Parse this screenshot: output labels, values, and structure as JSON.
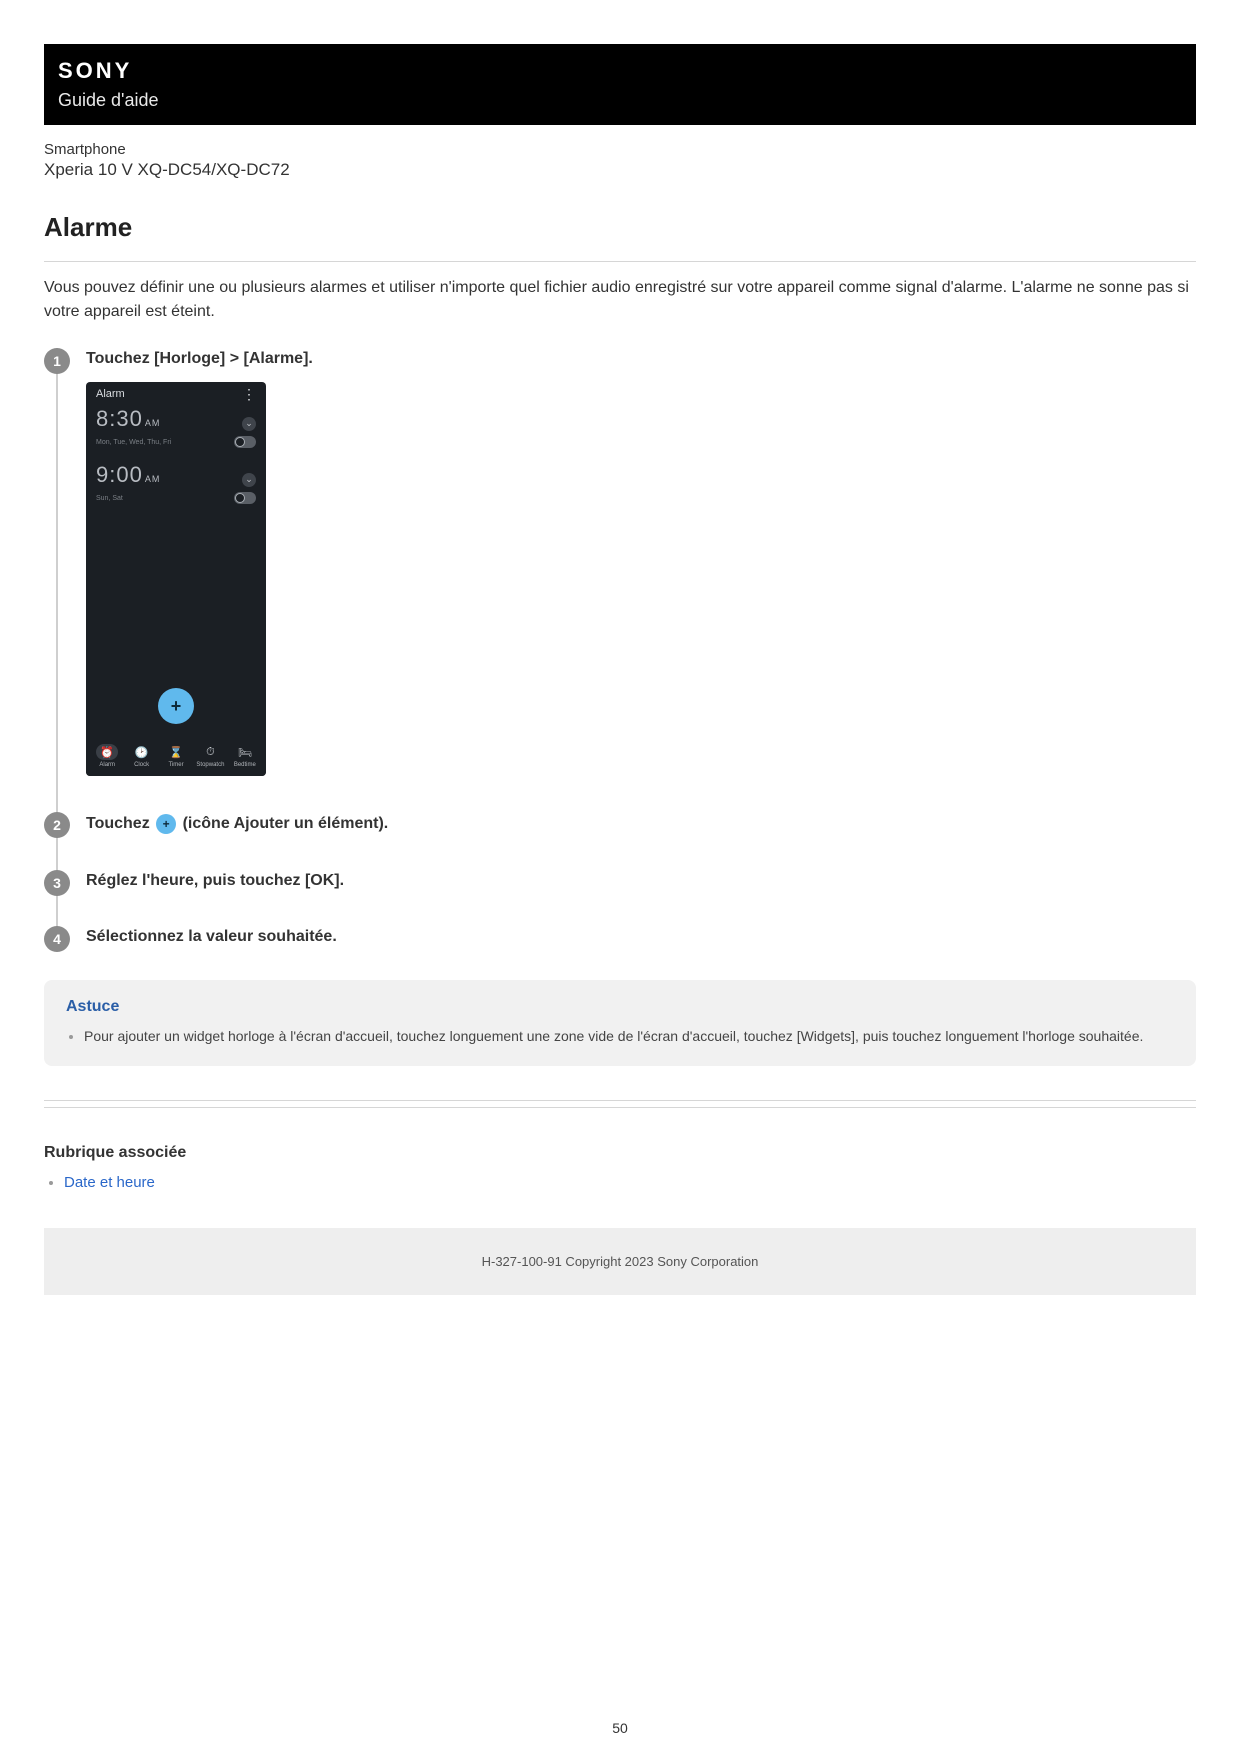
{
  "header": {
    "brand": "SONY",
    "guide_label": "Guide d'aide",
    "product_category": "Smartphone",
    "product_model": "Xperia 10 V XQ-DC54/XQ-DC72"
  },
  "page_title": "Alarme",
  "intro": "Vous pouvez définir une ou plusieurs alarmes et utiliser n'importe quel fichier audio enregistré sur votre appareil comme signal d'alarme. L'alarme ne sonne pas si votre appareil est éteint.",
  "steps": [
    {
      "num": "1",
      "text": "Touchez [Horloge] > [Alarme]."
    },
    {
      "num": "2",
      "text_before": "Touchez ",
      "text_after": " (icône Ajouter un élément)."
    },
    {
      "num": "3",
      "text": "Réglez l'heure, puis touchez [OK]."
    },
    {
      "num": "4",
      "text": "Sélectionnez la valeur souhaitée."
    }
  ],
  "phone": {
    "screen_title": "Alarm",
    "alarms": [
      {
        "time": "8:30",
        "ampm": "AM",
        "days": "Mon, Tue, Wed, Thu, Fri"
      },
      {
        "time": "9:00",
        "ampm": "AM",
        "days": "Sun, Sat"
      }
    ],
    "fab": "+",
    "tabs": [
      {
        "label": "Alarm",
        "icon": "⏰",
        "active": true
      },
      {
        "label": "Clock",
        "icon": "🕑",
        "active": false
      },
      {
        "label": "Timer",
        "icon": "⌛",
        "active": false
      },
      {
        "label": "Stopwatch",
        "icon": "⏱",
        "active": false
      },
      {
        "label": "Bedtime",
        "icon": "🛏",
        "active": false
      }
    ]
  },
  "tip": {
    "title": "Astuce",
    "items": [
      "Pour ajouter un widget horloge à l'écran d'accueil, touchez longuement une zone vide de l'écran d'accueil, touchez [Widgets], puis touchez longuement l'horloge souhaitée."
    ]
  },
  "related": {
    "title": "Rubrique associée",
    "links": [
      {
        "label": "Date et heure"
      }
    ]
  },
  "footer_copyright": "H-327-100-91 Copyright 2023 Sony Corporation",
  "page_number": "50"
}
